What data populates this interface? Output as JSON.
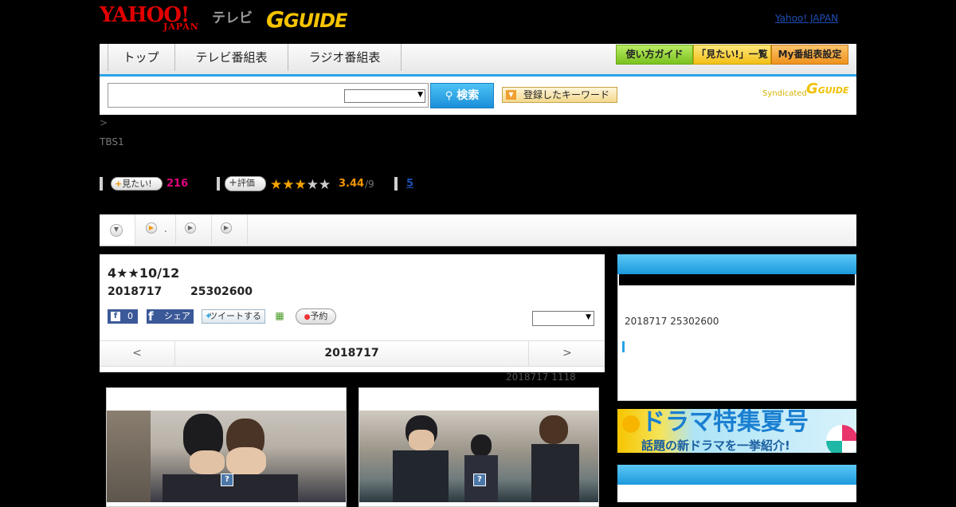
{
  "header": {
    "logo_yahoo": "YAHOO!",
    "logo_japan": "JAPAN",
    "logo_tv": "テレビ",
    "logo_gguide": "GUIDE",
    "top_link": "Yahoo! JAPAN"
  },
  "nav": {
    "tabs": [
      {
        "label": "トップ"
      },
      {
        "label": "テレビ番組表"
      },
      {
        "label": "ラジオ番組表"
      }
    ],
    "buttons": [
      {
        "label": "使い方ガイド",
        "color": "#8bd02b"
      },
      {
        "label": "「見たい!」一覧",
        "color": "#f6c81b"
      },
      {
        "label": "My番組表設定",
        "color": "#f29a21"
      }
    ]
  },
  "search": {
    "button_label": "検索",
    "keyword_label": "登録したキーワード",
    "syndicated_label": "Syndicated",
    "syndicated_logo": "GUIDE"
  },
  "meta": {
    "breadcrumb": ">",
    "channel": "TBS1",
    "mitai_label": "見たい!",
    "mitai_count": "216",
    "hyouka_label": "評価",
    "rating_value": "3.44",
    "rating_max": "/9",
    "rating_stars": 3,
    "link_count": "5"
  },
  "program": {
    "title": "4★★10/12",
    "date": "2018717",
    "time": "25302600",
    "fb_count": "0",
    "fb_share_label": "シェア",
    "tweet_label": "ツイートする",
    "reserve_label": "予約",
    "day_prev": "<",
    "day_current": "2018717",
    "day_next": ">",
    "update_text": "2018717  1118"
  },
  "side": {
    "air_text": "2018717  25302600"
  },
  "banner": {
    "title": "ドラマ特集夏号",
    "subtitle": "話題の新ドラマを一挙紹介!"
  },
  "photos": [
    {
      "qmark": "?"
    },
    {
      "qmark": "?"
    }
  ]
}
